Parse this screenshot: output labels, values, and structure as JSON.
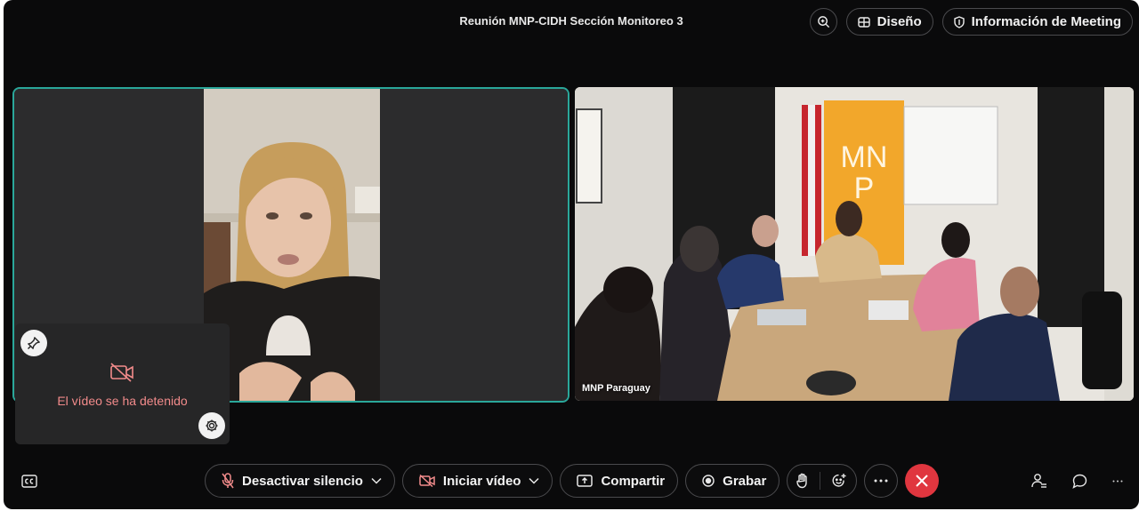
{
  "header": {
    "title": "Reunión MNP-CIDH Sección Monitoreo 3",
    "zoom_icon": "zoom-in-icon",
    "layout_label": "Diseño",
    "info_label": "Información de Meeting"
  },
  "tiles": {
    "right_label": "MNP Paraguay"
  },
  "selfview": {
    "status_text": "El vídeo se ha detenido"
  },
  "toolbar": {
    "mute_label": "Desactivar silencio",
    "video_label": "Iniciar vídeo",
    "share_label": "Compartir",
    "record_label": "Grabar"
  },
  "colors": {
    "background": "#0a0a0b",
    "active_speaker_border": "#2aa79a",
    "danger": "#e0363f",
    "status_text": "#f28b8b"
  }
}
